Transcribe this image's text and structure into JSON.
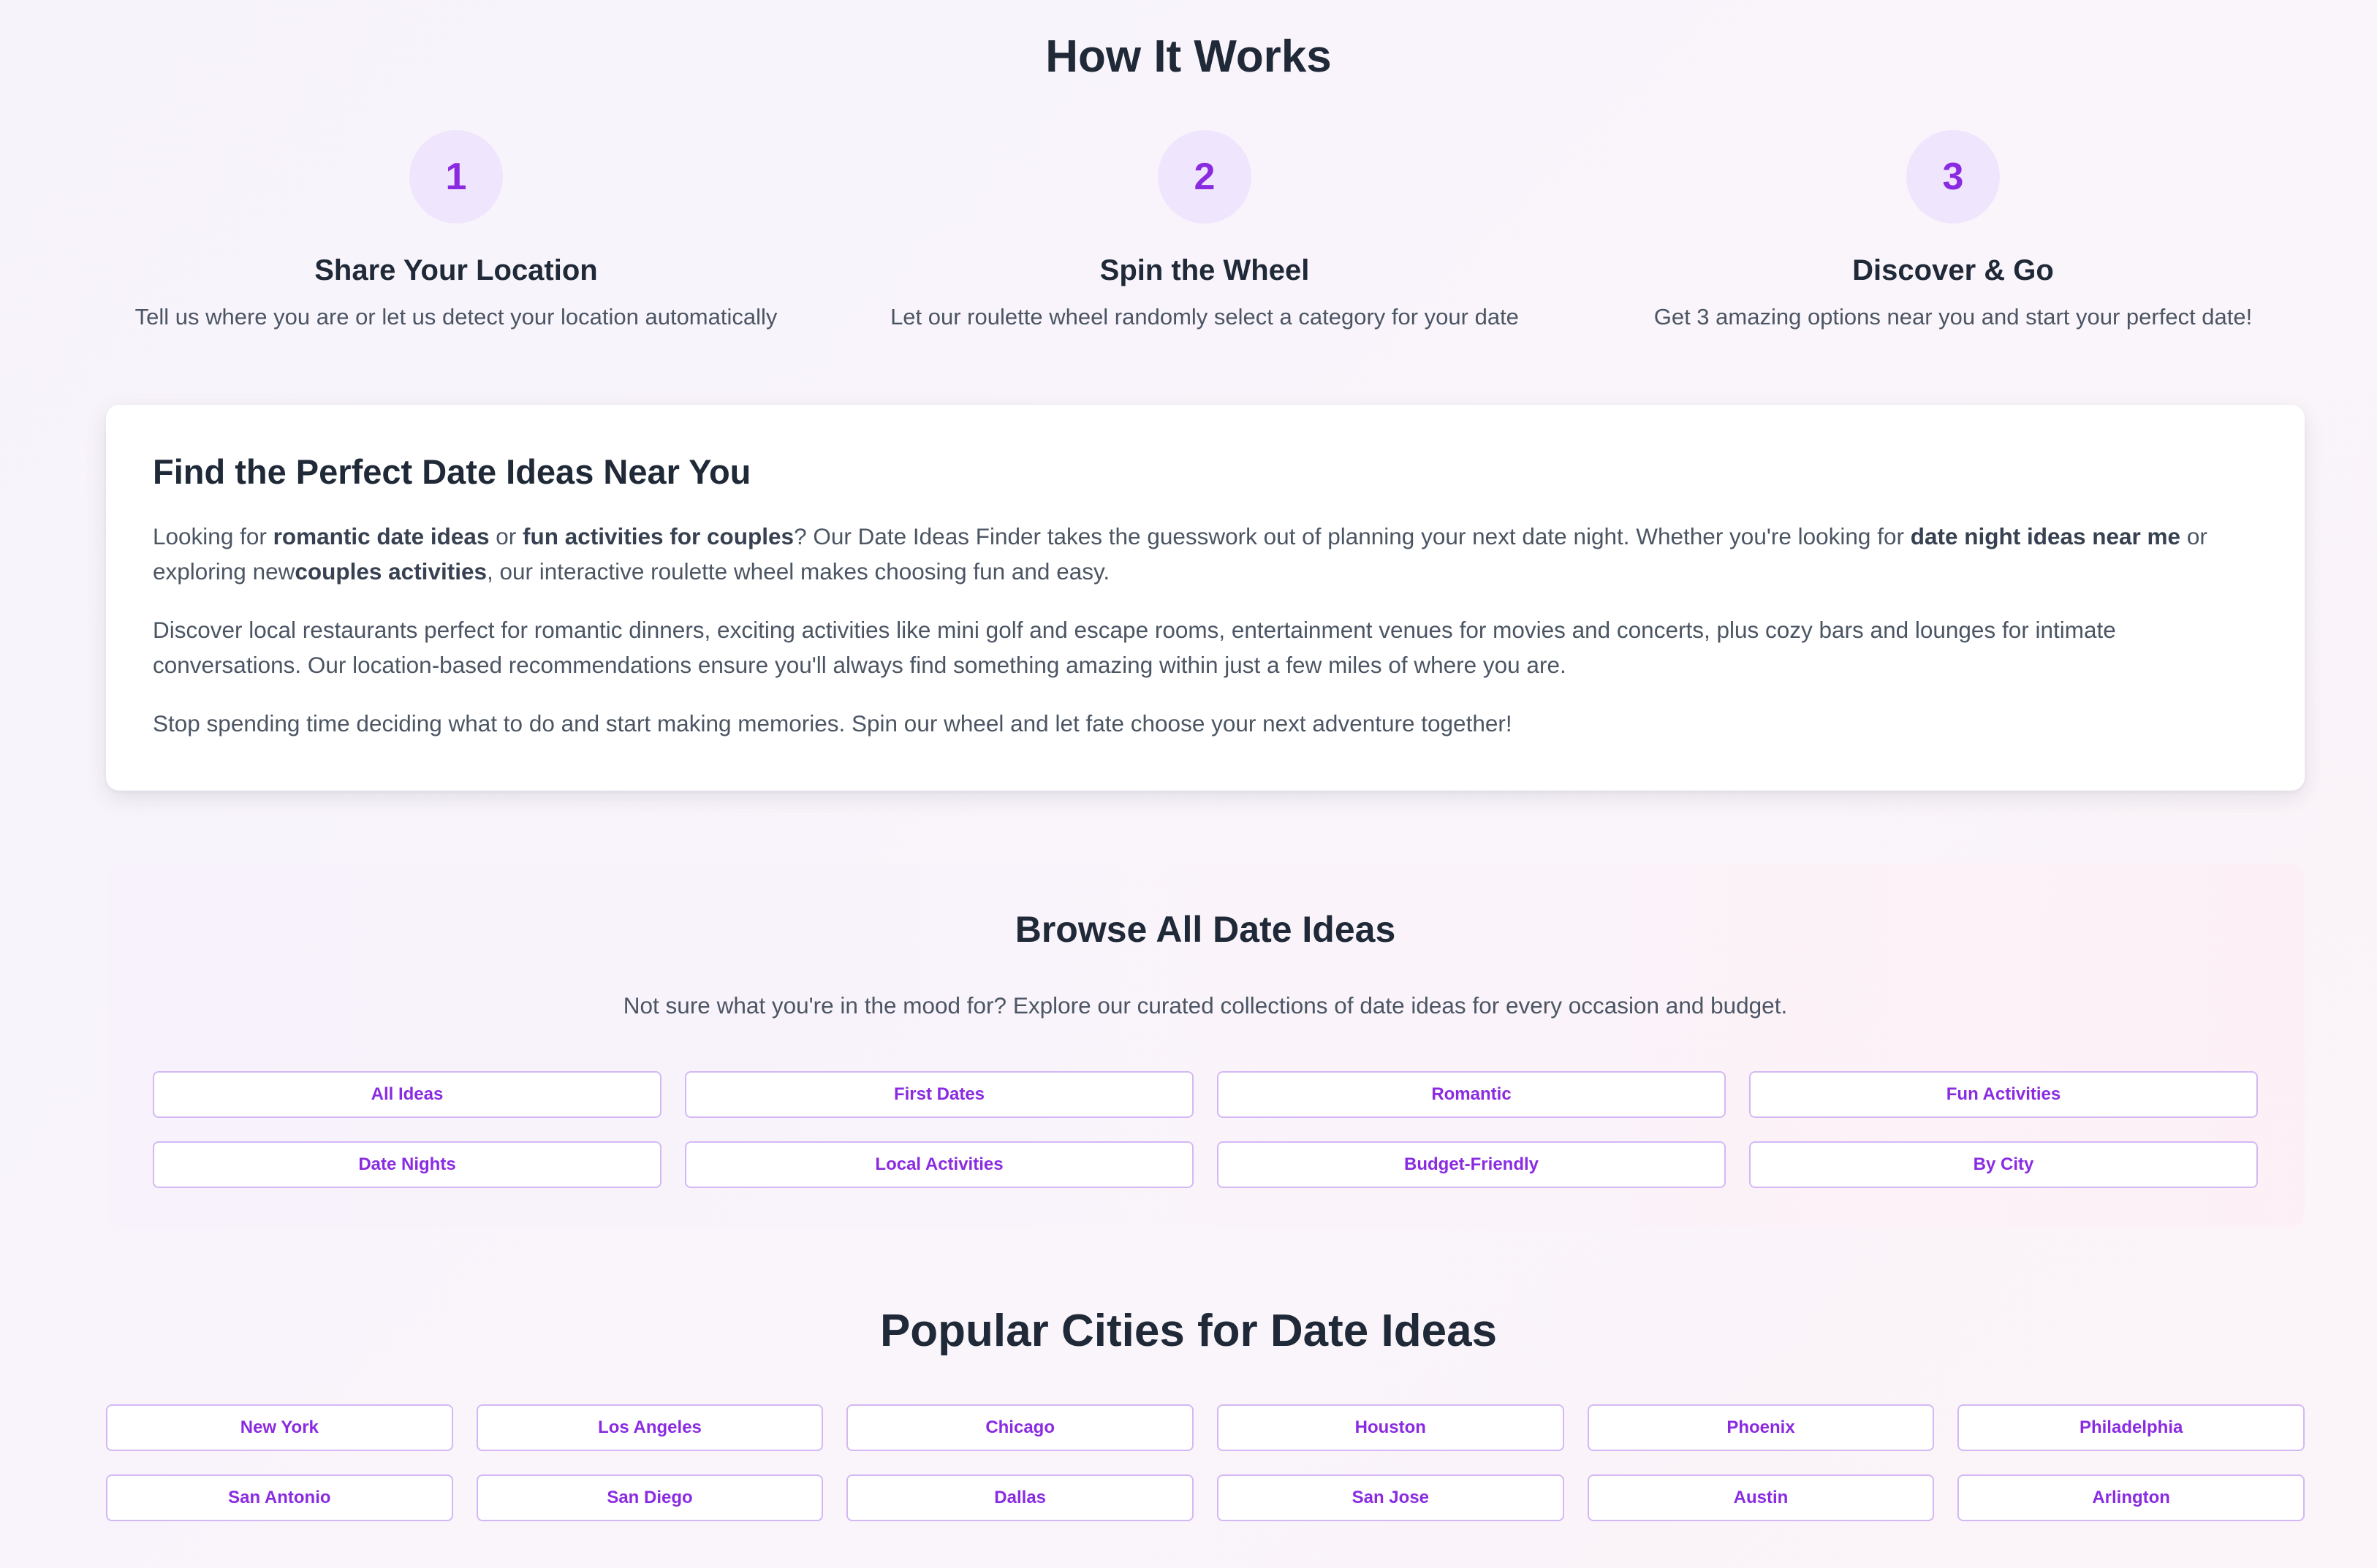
{
  "how_it_works": {
    "title": "How It Works",
    "steps": [
      {
        "number": "1",
        "title": "Share Your Location",
        "desc": "Tell us where you are or let us detect your location automatically"
      },
      {
        "number": "2",
        "title": "Spin the Wheel",
        "desc": "Let our roulette wheel randomly select a category for your date"
      },
      {
        "number": "3",
        "title": "Discover & Go",
        "desc": "Get 3 amazing options near you and start your perfect date!"
      }
    ]
  },
  "find_card": {
    "title": "Find the Perfect Date Ideas Near You",
    "p1": {
      "t1": "Looking for ",
      "b1": "romantic date ideas",
      "t2": " or ",
      "b2": "fun activities for couples",
      "t3": "? Our Date Ideas Finder takes the guesswork out of planning your next date night. Whether you're looking for ",
      "b3": "date night ideas near me",
      "t4": " or exploring new",
      "b4": "couples activities",
      "t5": ", our interactive roulette wheel makes choosing fun and easy."
    },
    "p2": "Discover local restaurants perfect for romantic dinners, exciting activities like mini golf and escape rooms, entertainment venues for movies and concerts, plus cozy bars and lounges for intimate conversations. Our location-based recommendations ensure you'll always find something amazing within just a few miles of where you are.",
    "p3": "Stop spending time deciding what to do and start making memories. Spin our wheel and let fate choose your next adventure together!"
  },
  "browse": {
    "title": "Browse All Date Ideas",
    "subtitle": "Not sure what you're in the mood for? Explore our curated collections of date ideas for every occasion and budget.",
    "buttons": [
      "All Ideas",
      "First Dates",
      "Romantic",
      "Fun Activities",
      "Date Nights",
      "Local Activities",
      "Budget-Friendly",
      "By City"
    ]
  },
  "cities": {
    "title": "Popular Cities for Date Ideas",
    "buttons": [
      "New York",
      "Los Angeles",
      "Chicago",
      "Houston",
      "Phoenix",
      "Philadelphia",
      "San Antonio",
      "San Diego",
      "Dallas",
      "San Jose",
      "Austin",
      "Arlington"
    ]
  },
  "colors": {
    "accent": "#8a2be2",
    "circle_bg": "#efe6fd",
    "pill_border": "#d4b8f5",
    "heading": "#1f2937",
    "body_text": "#4b5563"
  }
}
